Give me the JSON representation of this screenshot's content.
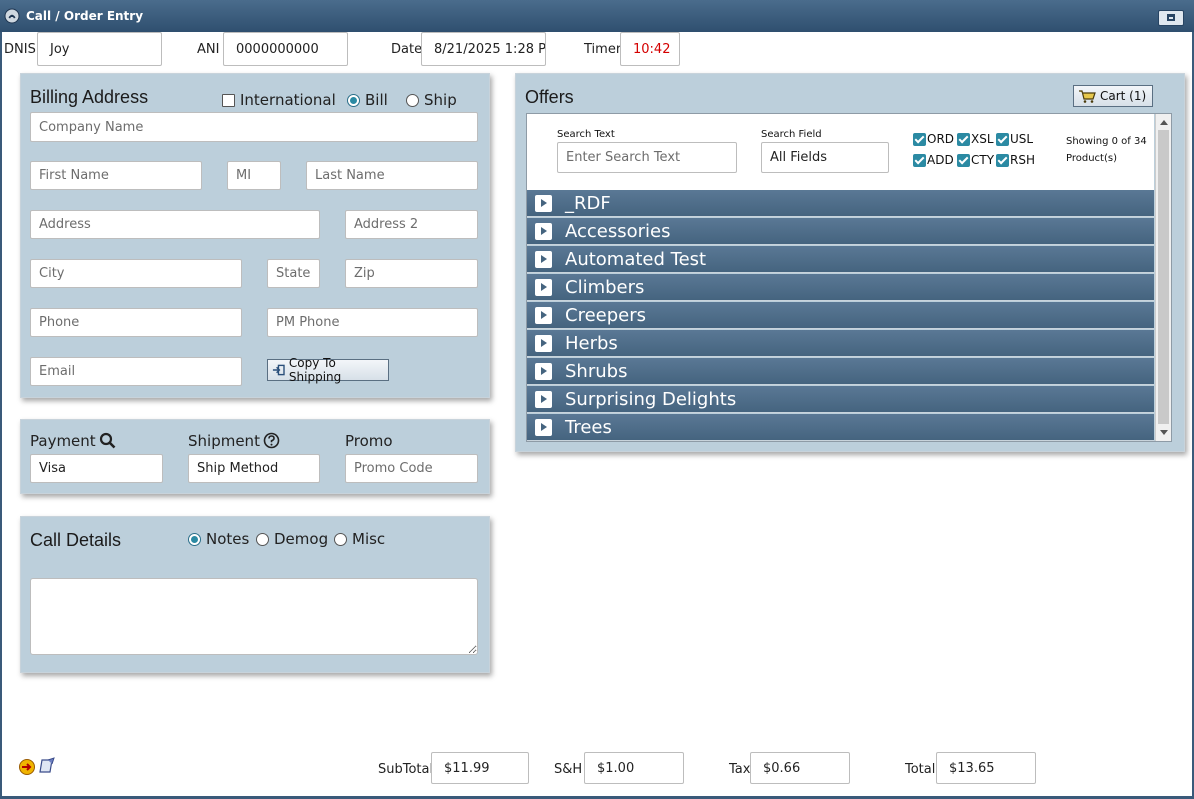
{
  "window": {
    "title": "Call / Order Entry"
  },
  "header": {
    "dnis_label": "DNIS",
    "dnis_value": "Joy",
    "ani_label": "ANI",
    "ani_value": "0000000000",
    "date_label": "Date",
    "date_value": "8/21/2025 1:28 P",
    "timer_label": "Timer",
    "timer_value": "10:42",
    "timer_color": "#d40000"
  },
  "billing": {
    "title": "Billing Address",
    "international_label": "International",
    "bill_label": "Bill",
    "ship_label": "Ship",
    "company_placeholder": "Company Name",
    "first_name_placeholder": "First Name",
    "mi_placeholder": "MI",
    "last_name_placeholder": "Last Name",
    "address_placeholder": "Address",
    "address2_placeholder": "Address 2",
    "city_placeholder": "City",
    "state_placeholder": "State",
    "zip_placeholder": "Zip",
    "phone_placeholder": "Phone",
    "pm_phone_placeholder": "PM Phone",
    "email_placeholder": "Email",
    "copy_button_label": "Copy To Shipping"
  },
  "payment": {
    "payment_label": "Payment",
    "payment_value": "Visa",
    "shipment_label": "Shipment",
    "shipment_value": "Ship Method",
    "promo_label": "Promo",
    "promo_placeholder": "Promo Code"
  },
  "call_details": {
    "title": "Call Details",
    "notes_label": "Notes",
    "demog_label": "Demog",
    "misc_label": "Misc"
  },
  "offers": {
    "title": "Offers",
    "cart_label": "Cart (1)",
    "search_text_label": "Search Text",
    "search_text_placeholder": "Enter Search Text",
    "search_field_label": "Search Field",
    "search_field_value": "All Fields",
    "filters": [
      "ORD",
      "XSL",
      "USL",
      "ADD",
      "CTY",
      "RSH"
    ],
    "showing_line1": "Showing 0 of 34",
    "showing_line2": "Product(s)",
    "categories": [
      "_RDF",
      "Accessories",
      "Automated Test",
      "Climbers",
      "Creepers",
      "Herbs",
      "Shrubs",
      "Surprising Delights",
      "Trees"
    ]
  },
  "totals": {
    "subtotal_label": "SubTotal",
    "subtotal_value": "$11.99",
    "sh_label": "S&H",
    "sh_value": "$1.00",
    "tax_label": "Tax",
    "tax_value": "$0.66",
    "total_label": "Total",
    "total_value": "$13.65"
  },
  "icons": {
    "app": "phone-icon",
    "search": "magnifier-icon",
    "help": "question-circle-icon",
    "copy": "arrow-into-box-icon",
    "cart": "cart-icon",
    "footer_left": "exit-icon",
    "footer_right": "script-icon"
  }
}
